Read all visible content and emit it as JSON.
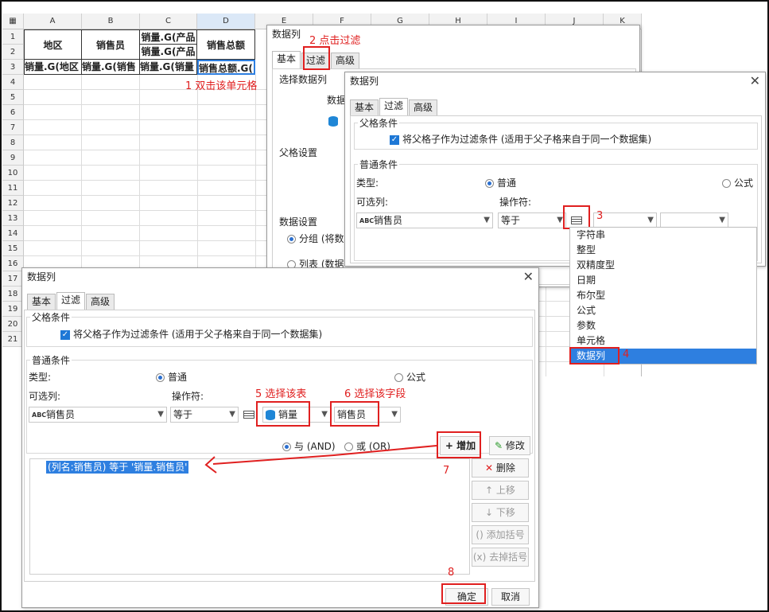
{
  "spreadsheet": {
    "columns": [
      "A",
      "B",
      "C",
      "D",
      "E",
      "F",
      "G",
      "H",
      "I",
      "J",
      "K"
    ],
    "rows": [
      "1",
      "2",
      "3",
      "4",
      "5",
      "6",
      "7",
      "8",
      "9",
      "10",
      "11",
      "12",
      "13",
      "14",
      "15",
      "16",
      "17",
      "18",
      "19",
      "20",
      "21"
    ],
    "header_cells": {
      "a": "地区",
      "b": "销售员",
      "c1": "销量.G(产品",
      "c2": "销量.G(产品",
      "d": "销售总额"
    },
    "row3": {
      "a": "销量.G(地区",
      "b": "销量.G(销售",
      "c": "销量.G(销量",
      "d": "销售总额.G("
    }
  },
  "back_dialog": {
    "title": "数据列",
    "tabs": [
      "基本",
      "过滤",
      "高级"
    ],
    "labels": {
      "select_col": "选择数据列",
      "dataset": "数据",
      "parent": "父格设置",
      "data_setting": "数据设置",
      "group": "分组 (将数",
      "list": "列表 (数据"
    }
  },
  "right_dialog": {
    "title": "数据列",
    "tabs": [
      "基本",
      "过滤",
      "高级"
    ],
    "parent_legend": "父格条件",
    "parent_check": "将父格子作为过滤条件 (适用于父子格来自于同一个数据集)",
    "normal_legend": "普通条件",
    "type_label": "类型:",
    "type_normal": "普通",
    "type_formula": "公式",
    "optional_col_label": "可选列:",
    "operator_label": "操作符:",
    "col_value": "销售员",
    "op_value": "等于"
  },
  "type_menu": {
    "items": [
      "字符串",
      "整型",
      "双精度型",
      "日期",
      "布尔型",
      "公式",
      "参数",
      "单元格",
      "数据列"
    ]
  },
  "front_dialog": {
    "title": "数据列",
    "tabs": [
      "基本",
      "过滤",
      "高级"
    ],
    "parent_legend": "父格条件",
    "parent_check": "将父格子作为过滤条件 (适用于父子格来自于同一个数据集)",
    "normal_legend": "普通条件",
    "type_label": "类型:",
    "type_normal": "普通",
    "type_formula": "公式",
    "optional_col_label": "可选列:",
    "operator_label": "操作符:",
    "col_value": "销售员",
    "op_value": "等于",
    "table_value": "销量",
    "field_value": "销售员",
    "and_label": "与 (AND)",
    "or_label": "或 (OR)",
    "add_label": "增加",
    "modify_label": "修改",
    "delete_label": "删除",
    "up_label": "上移",
    "down_label": "下移",
    "add_bracket_label": "添加括号",
    "remove_bracket_label": "去掉括号",
    "condition_text": "(列名:销售员) 等于 '销量.销售员'",
    "ok_label": "确定",
    "cancel_label": "取消"
  },
  "annotations": {
    "a1": "1 双击该单元格",
    "a2": "2 点击过滤",
    "a3": "3",
    "a4": "4",
    "a5": "5 选择该表",
    "a6": "6 选择该字段",
    "a7": "7",
    "a8": "8"
  },
  "colors": {
    "accent": "#2e7fe0",
    "annotation": "#e02020",
    "check": "#1e78d6"
  }
}
